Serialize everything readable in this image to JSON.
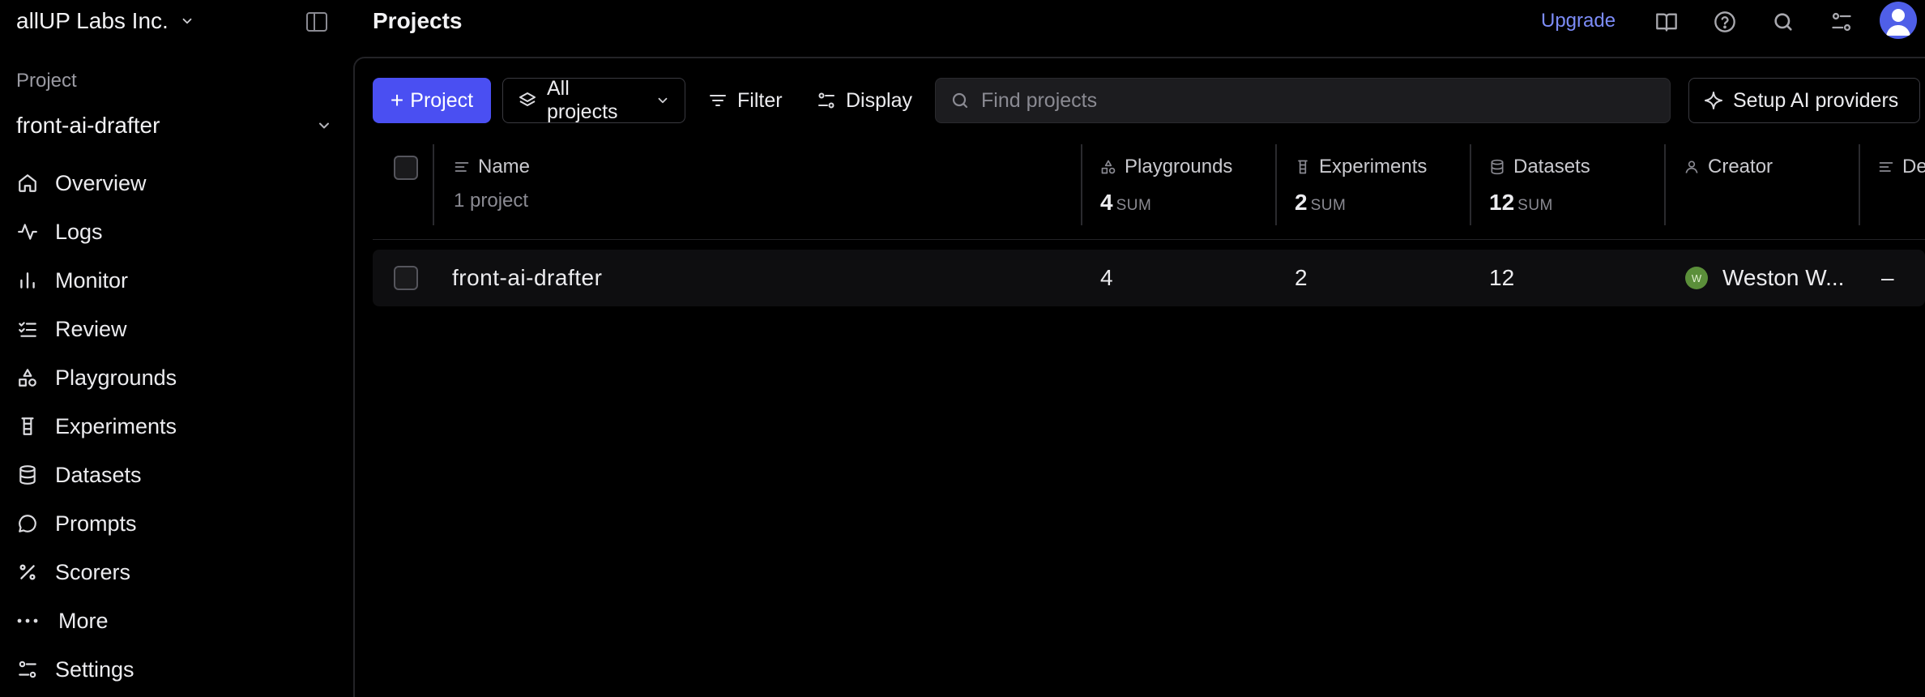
{
  "sidebar": {
    "org_name": "allUP Labs Inc.",
    "project_label": "Project",
    "project_name": "front-ai-drafter",
    "items": [
      {
        "label": "Overview",
        "icon": "home-icon"
      },
      {
        "label": "Logs",
        "icon": "activity-icon"
      },
      {
        "label": "Monitor",
        "icon": "bar-chart-icon"
      },
      {
        "label": "Review",
        "icon": "list-check-icon"
      },
      {
        "label": "Playgrounds",
        "icon": "shapes-icon"
      },
      {
        "label": "Experiments",
        "icon": "beaker-icon"
      },
      {
        "label": "Datasets",
        "icon": "database-icon"
      },
      {
        "label": "Prompts",
        "icon": "message-icon"
      },
      {
        "label": "Scorers",
        "icon": "percent-icon"
      },
      {
        "label": "More",
        "icon": "ellipsis-icon"
      },
      {
        "label": "Settings",
        "icon": "settings-icon"
      }
    ]
  },
  "header": {
    "title": "Projects",
    "upgrade_label": "Upgrade",
    "accent_color": "#7c8cf8"
  },
  "toolbar": {
    "new_project_label": "Project",
    "scope_label": "All projects",
    "filter_label": "Filter",
    "display_label": "Display",
    "search_placeholder": "Find projects",
    "setup_label": "Setup AI providers",
    "primary_color": "#4a4ff2"
  },
  "table": {
    "columns": {
      "name": {
        "label": "Name",
        "sub": "1 project"
      },
      "playgrounds": {
        "label": "Playgrounds",
        "sum": "4",
        "sum_label": "SUM"
      },
      "experiments": {
        "label": "Experiments",
        "sum": "2",
        "sum_label": "SUM"
      },
      "datasets": {
        "label": "Datasets",
        "sum": "12",
        "sum_label": "SUM"
      },
      "creator": {
        "label": "Creator"
      },
      "description": {
        "label": "De"
      }
    },
    "rows": [
      {
        "name": "front-ai-drafter",
        "playgrounds": "4",
        "experiments": "2",
        "datasets": "12",
        "creator_initial": "W",
        "creator": "Weston W...",
        "description": "–"
      }
    ]
  }
}
